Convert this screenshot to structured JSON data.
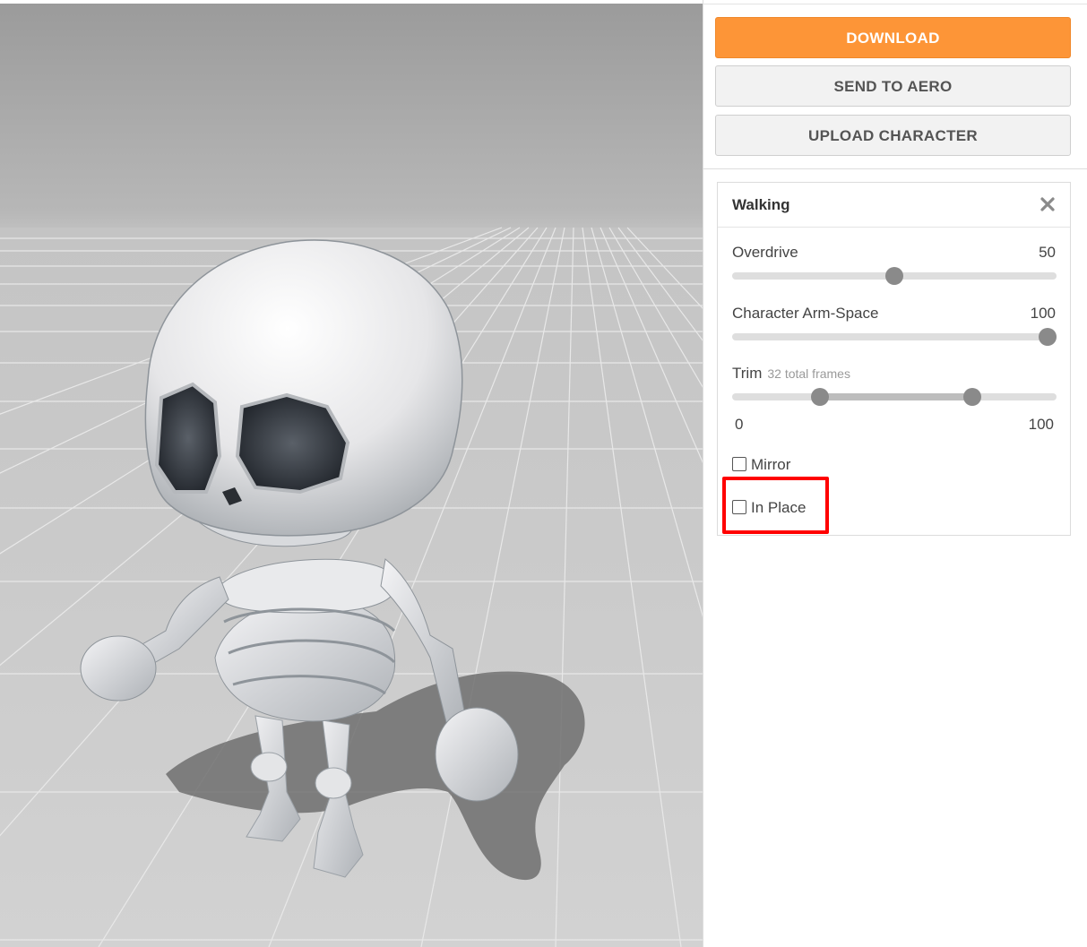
{
  "buttons": {
    "download": "DOWNLOAD",
    "send_to_aero": "SEND TO AERO",
    "upload_character": "UPLOAD CHARACTER"
  },
  "animation": {
    "title": "Walking",
    "close_icon": "close-icon",
    "sliders": {
      "overdrive": {
        "label": "Overdrive",
        "value": "50",
        "min": 0,
        "max": 100,
        "position": 50
      },
      "arm_space": {
        "label": "Character Arm-Space",
        "value": "100",
        "min": 0,
        "max": 100,
        "position": 100
      },
      "trim": {
        "label": "Trim",
        "sub": "32 total frames",
        "min_label": "0",
        "max_label": "100",
        "range_start": 27,
        "range_end": 74
      }
    },
    "checkboxes": {
      "mirror": {
        "label": "Mirror",
        "checked": false
      },
      "in_place": {
        "label": "In Place",
        "checked": false
      }
    }
  },
  "colors": {
    "download_bg": "#fd9537",
    "highlight": "#ff0000"
  }
}
